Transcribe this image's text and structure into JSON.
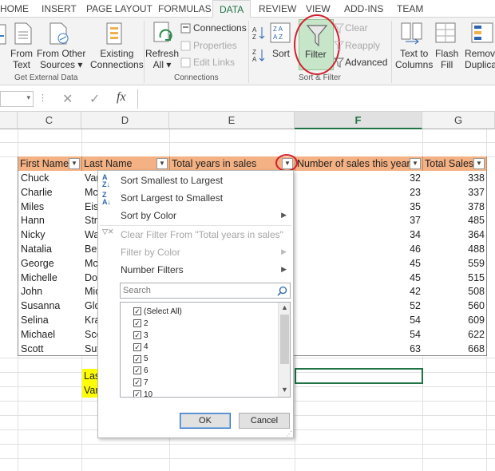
{
  "ribbon_tabs": [
    "HOME",
    "INSERT",
    "PAGE LAYOUT",
    "FORMULAS",
    "DATA",
    "REVIEW",
    "VIEW",
    "ADD-INS",
    "TEAM"
  ],
  "active_tab": "DATA",
  "ribbon": {
    "get_external": {
      "from_text": [
        "From",
        "Text"
      ],
      "from_other": [
        "From Other",
        "Sources ▾"
      ],
      "existing": [
        "Existing",
        "Connections"
      ],
      "label": "Get External Data"
    },
    "connections": {
      "refresh": [
        "Refresh",
        "All ▾"
      ],
      "connections": "Connections",
      "properties": "Properties",
      "edit_links": "Edit Links",
      "label": "Connections"
    },
    "sort_filter": {
      "sort": "Sort",
      "filter": "Filter",
      "clear": "Clear",
      "reapply": "Reapply",
      "advanced": "Advanced",
      "label": "Sort & Filter"
    },
    "data_tools": {
      "text_to_columns": [
        "Text to",
        "Columns"
      ],
      "flash_fill": [
        "Flash",
        "Fill"
      ],
      "remove_duplicates": [
        "Remove",
        "Duplicat"
      ]
    }
  },
  "formula_bar": {
    "fx": "fx",
    "name_box": ""
  },
  "columns": [
    "C",
    "D",
    "E",
    "F",
    "G"
  ],
  "selected_column": "F",
  "table": {
    "headers": [
      "First Name",
      "Last Name",
      "Total years in sales",
      "Number of sales this year",
      "Total Sales"
    ],
    "rows": [
      {
        "first": "Chuck",
        "last": "Var",
        "sales_year": "32",
        "total": "338"
      },
      {
        "first": "Charlie",
        "last": "Mc",
        "sales_year": "23",
        "total": "337"
      },
      {
        "first": "Miles",
        "last": "Eise",
        "sales_year": "35",
        "total": "378"
      },
      {
        "first": "Hann",
        "last": "Stri",
        "sales_year": "37",
        "total": "485"
      },
      {
        "first": "Nicky",
        "last": "Wa",
        "sales_year": "34",
        "total": "364"
      },
      {
        "first": "Natalia",
        "last": "Ber",
        "sales_year": "46",
        "total": "488"
      },
      {
        "first": "George",
        "last": "Mc",
        "sales_year": "45",
        "total": "559"
      },
      {
        "first": "Michelle",
        "last": "Dol",
        "sales_year": "45",
        "total": "515"
      },
      {
        "first": "John",
        "last": "Mic",
        "sales_year": "42",
        "total": "508"
      },
      {
        "first": "Susanna",
        "last": "Glo",
        "sales_year": "52",
        "total": "560"
      },
      {
        "first": "Selina",
        "last": "Kra",
        "sales_year": "54",
        "total": "609"
      },
      {
        "first": "Michael",
        "last": "Sco",
        "sales_year": "54",
        "total": "622"
      },
      {
        "first": "Scott",
        "last": "Sut",
        "sales_year": "63",
        "total": "668"
      }
    ]
  },
  "extra_cells": [
    "Las",
    "Var"
  ],
  "highlight_color": "#ffff00",
  "header_fill": "#f4b183",
  "filter_menu": {
    "sort_asc": "Sort Smallest to Largest",
    "sort_desc": "Sort Largest to Smallest",
    "sort_color": "Sort by Color",
    "clear_filter": "Clear Filter From \"Total years in sales\"",
    "filter_color": "Filter by Color",
    "number_filters": "Number Filters",
    "search_placeholder": "Search",
    "checklist": [
      "(Select All)",
      "2",
      "3",
      "4",
      "5",
      "6",
      "7",
      "10"
    ],
    "ok": "OK",
    "cancel": "Cancel"
  }
}
